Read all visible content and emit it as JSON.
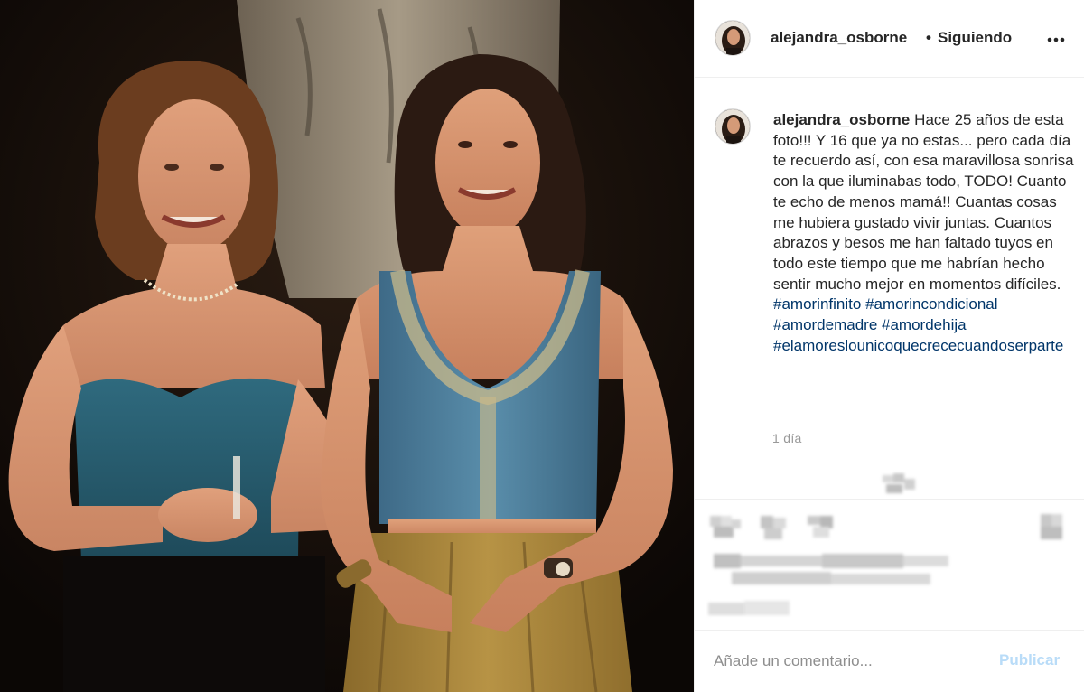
{
  "header": {
    "username": "alejandra_osborne",
    "separator": "•",
    "follow_status": "Siguiendo"
  },
  "caption": {
    "username": "alejandra_osborne",
    "text": "Hace 25 años de esta foto!!! Y 16 que ya no estas... pero cada día te recuerdo así, con esa maravillosa sonrisa con la que iluminabas todo, TODO! Cuanto te echo de menos mamá!! Cuantas cosas me hubiera gustado vivir juntas. Cuantos abrazos y besos me han faltado tuyos en todo este tiempo que me habrían hecho sentir mucho mejor en momentos difíciles.",
    "hashtags": [
      "#amorinfinito",
      "#amorincondicional",
      "#amordemadre",
      "#amordehija",
      "#elamoreslounicoquecrececuandoserparte"
    ]
  },
  "timestamp": "1 día",
  "comment": {
    "placeholder": "Añade un comentario...",
    "submit_label": "Publicar"
  },
  "icons": {
    "more": "more-options-icon",
    "like": "heart-icon",
    "comment": "comment-icon",
    "share": "share-icon",
    "save": "bookmark-icon"
  },
  "colors": {
    "hashtag": "#003569",
    "username": "#262626",
    "muted": "#999999",
    "publish_disabled": "#b9dcf8",
    "divider": "#efefef"
  }
}
